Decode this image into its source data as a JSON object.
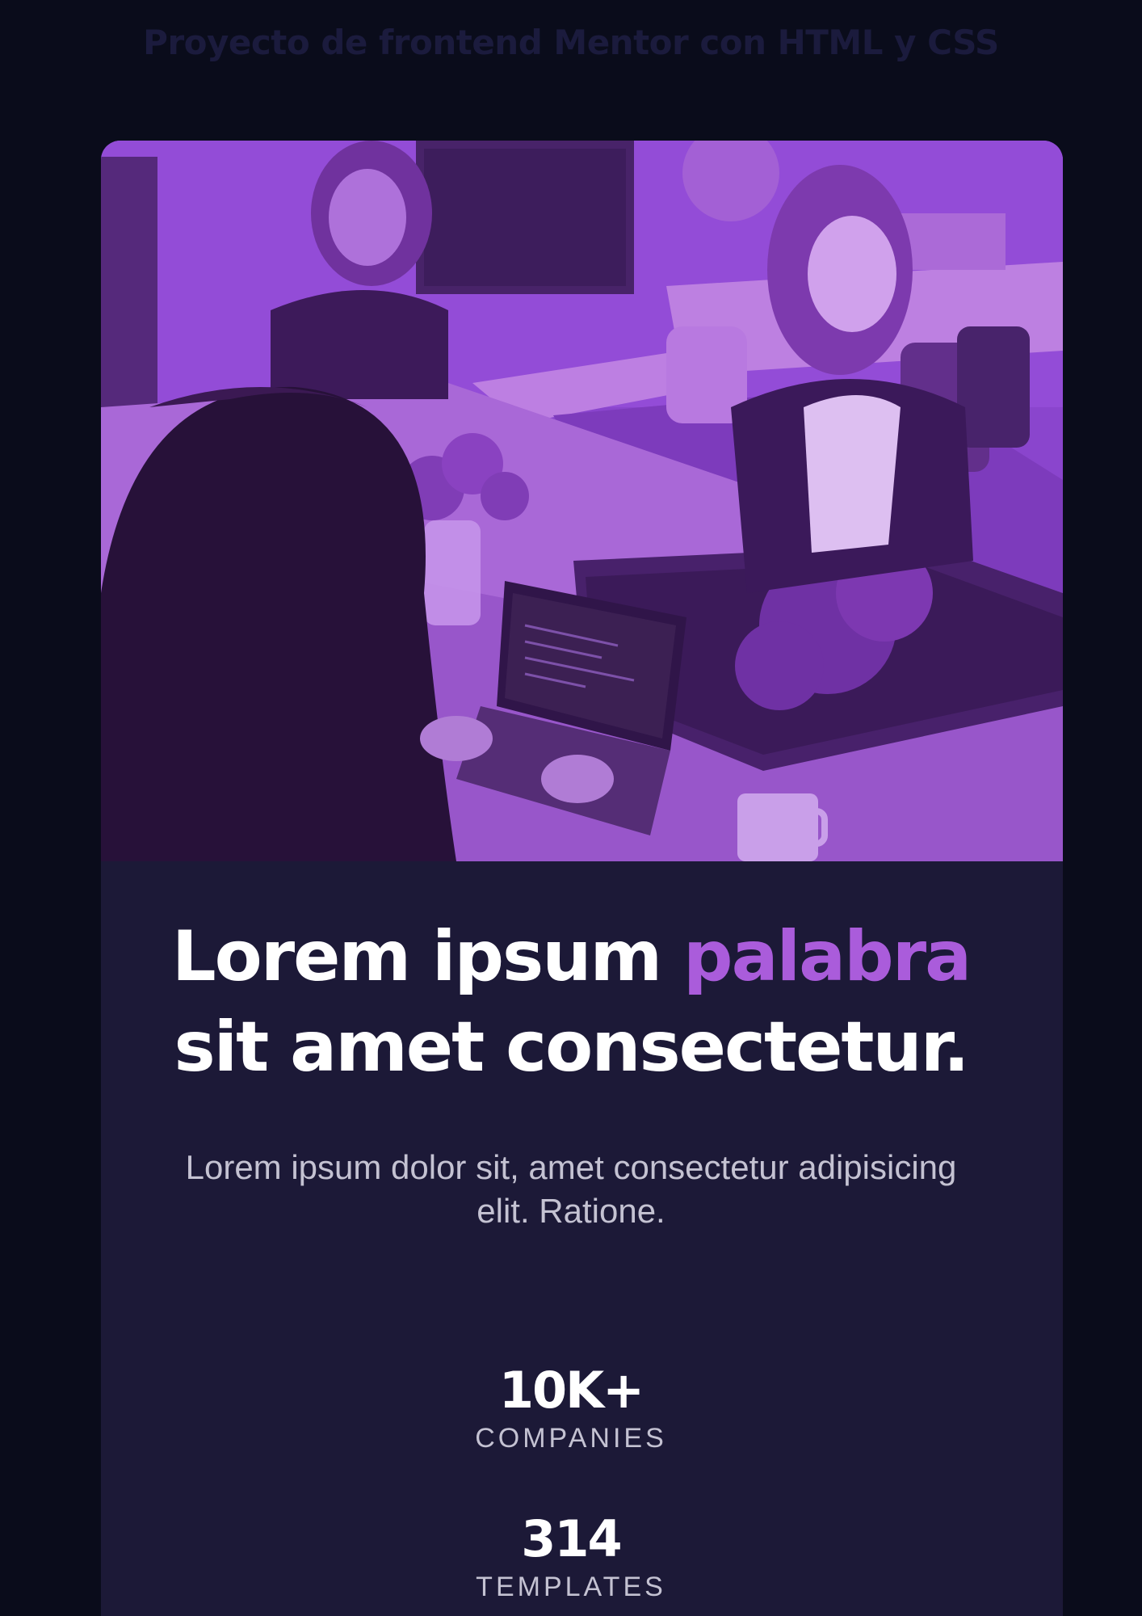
{
  "page": {
    "heading": "Proyecto de frontend Mentor con HTML y CSS"
  },
  "card": {
    "image_alt": "Women working together at a shared desk with laptops",
    "headline_start": "Lorem ipsum ",
    "headline_accent": "palabra",
    "headline_end": "sit amet consectetur.",
    "description": "Lorem ipsum dolor sit, amet consectetur adipisicing elit. Ratione.",
    "stats": [
      {
        "value": "10K+",
        "label": "COMPANIES"
      },
      {
        "value": "314",
        "label": "TEMPLATES"
      }
    ]
  },
  "colors": {
    "background": "#0a0c1b",
    "card": "#1c1937",
    "accent": "#aa5cdb",
    "image_tint": "#8844c9",
    "text_primary": "#ffffff",
    "text_muted": "#c4c2d2",
    "heading_dim": "#1b1b3d"
  }
}
